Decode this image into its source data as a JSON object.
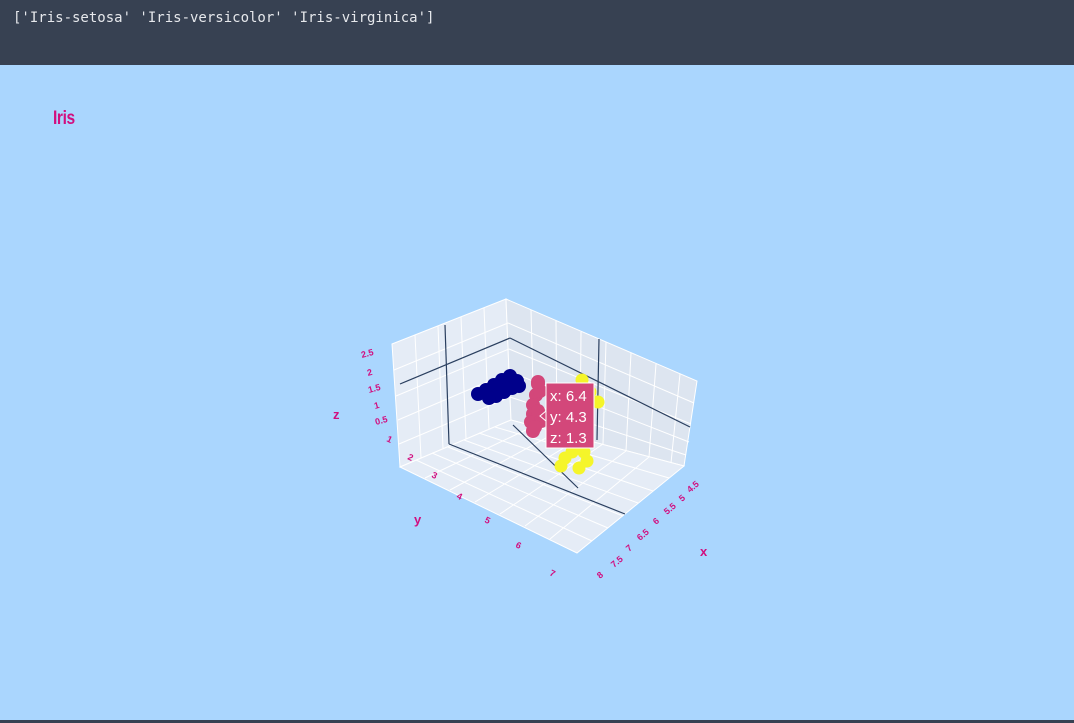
{
  "output": {
    "text": "['Iris-setosa' 'Iris-versicolor' 'Iris-virginica']"
  },
  "plot": {
    "title": "Iris",
    "background": "#aad6fe",
    "scene_background": "#e5ecf6",
    "font_color": "#d10f7f"
  },
  "chart_data": {
    "type": "scatter",
    "dimensions": 3,
    "axes": {
      "x": {
        "label": "x",
        "range": [
          4.5,
          8
        ],
        "ticks": [
          "4.5",
          "5",
          "5.5",
          "6",
          "6.5",
          "7",
          "7.5",
          "8"
        ]
      },
      "y": {
        "label": "y",
        "range": [
          1,
          7
        ],
        "ticks": [
          "1",
          "2",
          "3",
          "4",
          "5",
          "6",
          "7"
        ]
      },
      "z": {
        "label": "z",
        "range": [
          0.5,
          2.5
        ],
        "ticks": [
          "0.5",
          "1",
          "1.5",
          "2",
          "2.5"
        ]
      }
    },
    "series": [
      {
        "color": "#00008b",
        "cluster": "setosa"
      },
      {
        "color": "#d3477a",
        "cluster": "versicolor"
      },
      {
        "color": "#f5f52a",
        "cluster": "virginica"
      }
    ],
    "hover": {
      "lines": [
        "x: 6.4",
        "y: 4.3",
        "z: 1.3"
      ],
      "color": "#d3477a"
    }
  }
}
